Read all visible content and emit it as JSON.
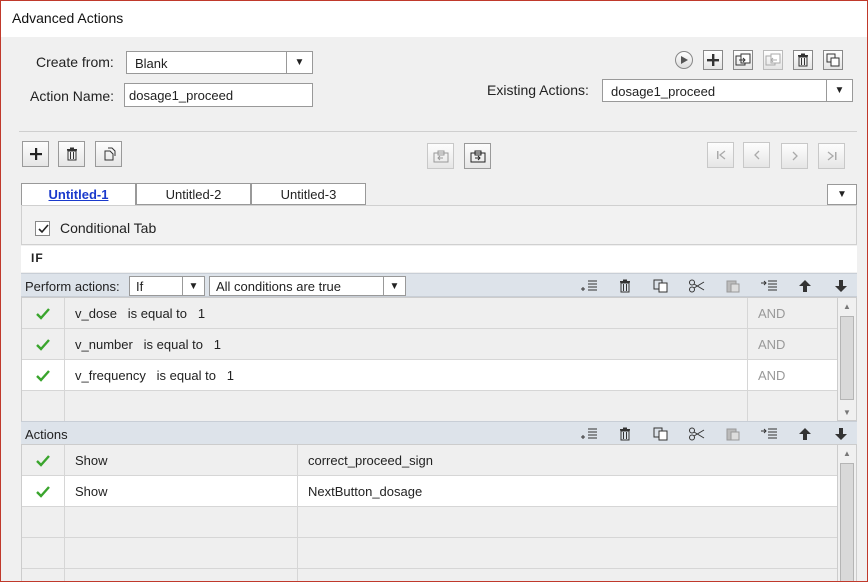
{
  "window": {
    "title": "Advanced Actions"
  },
  "form": {
    "create_from_label": "Create from:",
    "create_from_value": "Blank",
    "action_name_label": "Action Name:",
    "action_name_value": "dosage1_proceed",
    "existing_actions_label": "Existing Actions:",
    "existing_actions_value": "dosage1_proceed"
  },
  "tabs": [
    {
      "label": "Untitled-1",
      "active": true
    },
    {
      "label": "Untitled-2",
      "active": false
    },
    {
      "label": "Untitled-3",
      "active": false
    }
  ],
  "conditional": {
    "label": "Conditional Tab",
    "checked": true
  },
  "if_label": "IF",
  "perform": {
    "label": "Perform actions:",
    "mode": "If",
    "condition_mode": "All conditions are true"
  },
  "conditions": [
    {
      "var": "v_dose",
      "op": "is equal to",
      "val": "1",
      "join": "AND"
    },
    {
      "var": "v_number",
      "op": "is equal to",
      "val": "1",
      "join": "AND"
    },
    {
      "var": "v_frequency",
      "op": "is equal to",
      "val": "1",
      "join": "AND"
    }
  ],
  "actions_header": "Actions",
  "actions": [
    {
      "verb": "Show",
      "target": "correct_proceed_sign"
    },
    {
      "verb": "Show",
      "target": "NextButton_dosage"
    }
  ],
  "colors": {
    "check": "#3aa52d",
    "active_tab": "#1a3acc",
    "header_bg": "#dde3ea",
    "border": "#c0392b"
  }
}
